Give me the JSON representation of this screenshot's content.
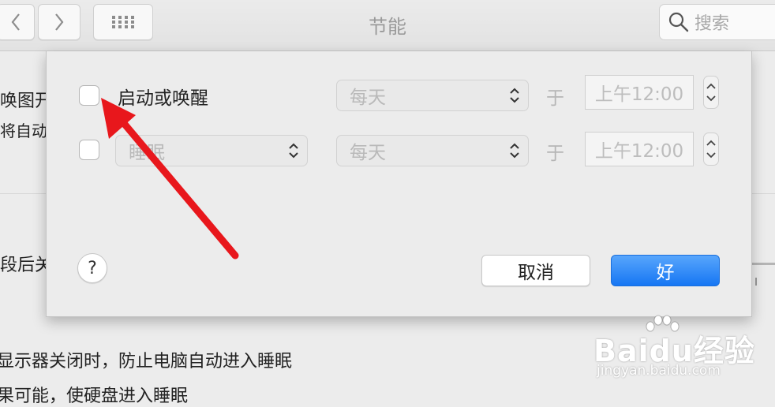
{
  "window": {
    "title": "节能",
    "nav_back_icon": "chevron-left-icon",
    "nav_forward_icon": "chevron-right-icon",
    "grid_icon": "grid-icon",
    "search": {
      "placeholder": "搜索",
      "icon": "search-icon"
    }
  },
  "background": {
    "line1": "唤图开",
    "line2": "将自动",
    "line3": "段后关",
    "line4": "显示器关闭时，防止电脑自动进入睡眠",
    "line5": "果可能，使硬盘进入睡眠"
  },
  "schedule": {
    "row1": {
      "checked": false,
      "label": "启动或唤醒",
      "day": "每天",
      "at": "于",
      "time": "上午12:00"
    },
    "row2": {
      "checked": false,
      "action": "睡眠",
      "day": "每天",
      "at": "于",
      "time": "上午12:00"
    }
  },
  "buttons": {
    "help": "?",
    "cancel": "取消",
    "ok": "好"
  },
  "watermark": {
    "main": "Baidu经验",
    "sub": "jingyan.baidu.com"
  },
  "colors": {
    "accent": "#1676f3",
    "annotation_arrow": "#e8171c"
  }
}
